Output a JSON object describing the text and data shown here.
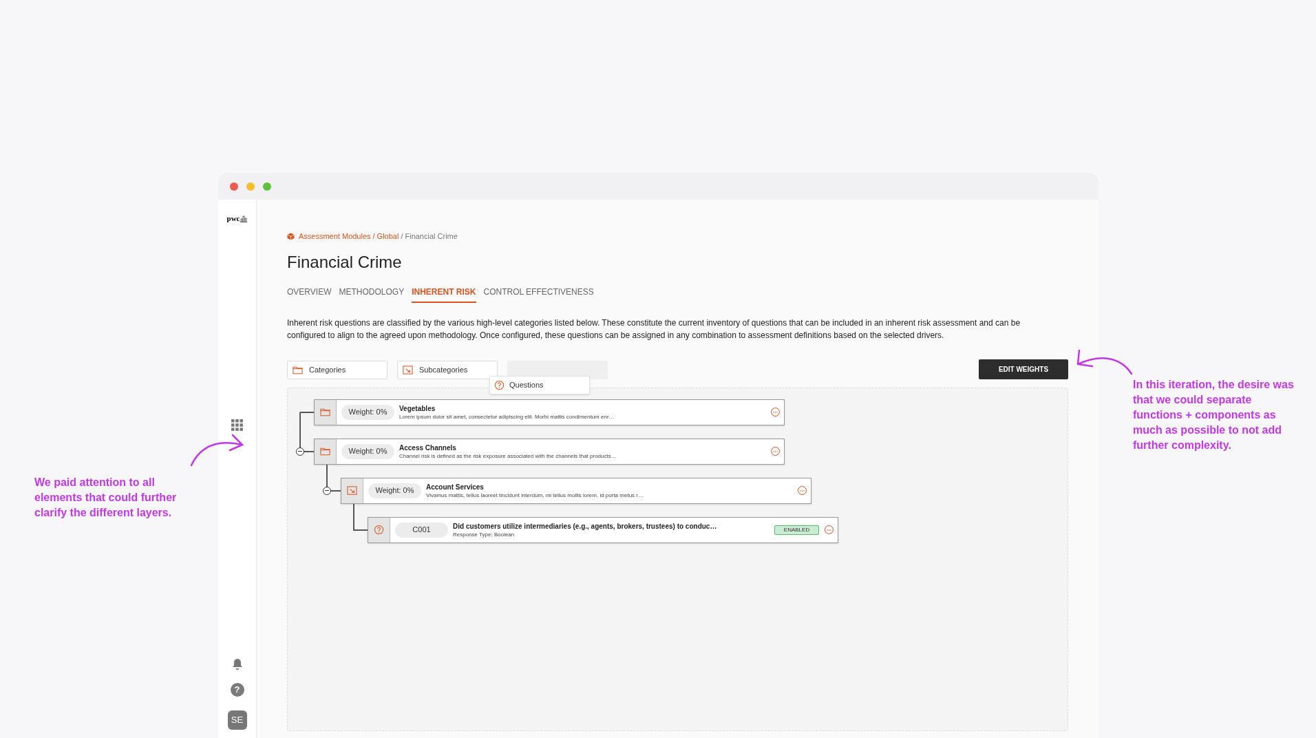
{
  "sidebar": {
    "logo": "pwc",
    "help": "?",
    "avatar": "SE"
  },
  "breadcrumb": {
    "links": [
      "Assessment Modules",
      "Global"
    ],
    "separators": [
      "/",
      "/"
    ],
    "current": "Financial Crime"
  },
  "title": "Financial Crime",
  "tabs": [
    {
      "label": "OVERVIEW",
      "selected": false
    },
    {
      "label": "METHODOLOGY",
      "selected": false
    },
    {
      "label": "INHERENT RISK",
      "selected": true
    },
    {
      "label": "CONTROL EFFECTIVENESS",
      "selected": false
    }
  ],
  "description": "Inherent risk questions are classified by the various high-level categories listed below. These constitute the current inventory of questions that can be included in an inherent risk assessment and can be configured to align to the agreed upon methodology. Once configured, these questions can be assigned in any combination to assessment definitions based on the selected drivers.",
  "toolbar": {
    "chips": [
      {
        "kind": "category",
        "label": "Categories"
      },
      {
        "kind": "subcategory",
        "label": "Subcategories"
      },
      {
        "kind": "empty"
      }
    ],
    "popover": {
      "kind": "question",
      "label": "Questions"
    },
    "button": "EDIT WEIGHTS"
  },
  "tree": [
    {
      "kind": "category",
      "badge": "Weight: 0%",
      "title": "Vegetables",
      "description": "Lorem ipsum dolor sit amet, consectetur adipiscing elit. Morbi mattis condimentum enr…",
      "expanded": false
    },
    {
      "kind": "category",
      "badge": "Weight: 0%",
      "title": "Access Channels",
      "description": "Channel risk is defined as the risk exposure associated with the channels that products…",
      "expanded": true,
      "children": [
        {
          "kind": "subcategory",
          "badge": "Weight: 0%",
          "title": "Account Services",
          "description": "Vivamus mattis, tellus laoreet tincidunt interdum, mi tellus mollis lorem, id porta metus r…",
          "expanded": true,
          "children": [
            {
              "kind": "question",
              "badge": "C001",
              "title": "Did customers utilize intermediaries (e.g., agents, brokers, trustees) to conduc…",
              "description": "Response Type: Boolean",
              "status": "ENABLED",
              "expanded": false
            }
          ]
        }
      ]
    }
  ],
  "annotations": [
    "We paid attention to all elements that could further clarify the different layers.",
    "In this iteration, the desire was that we could separate functions + components as much as possible to not add further complexity."
  ]
}
